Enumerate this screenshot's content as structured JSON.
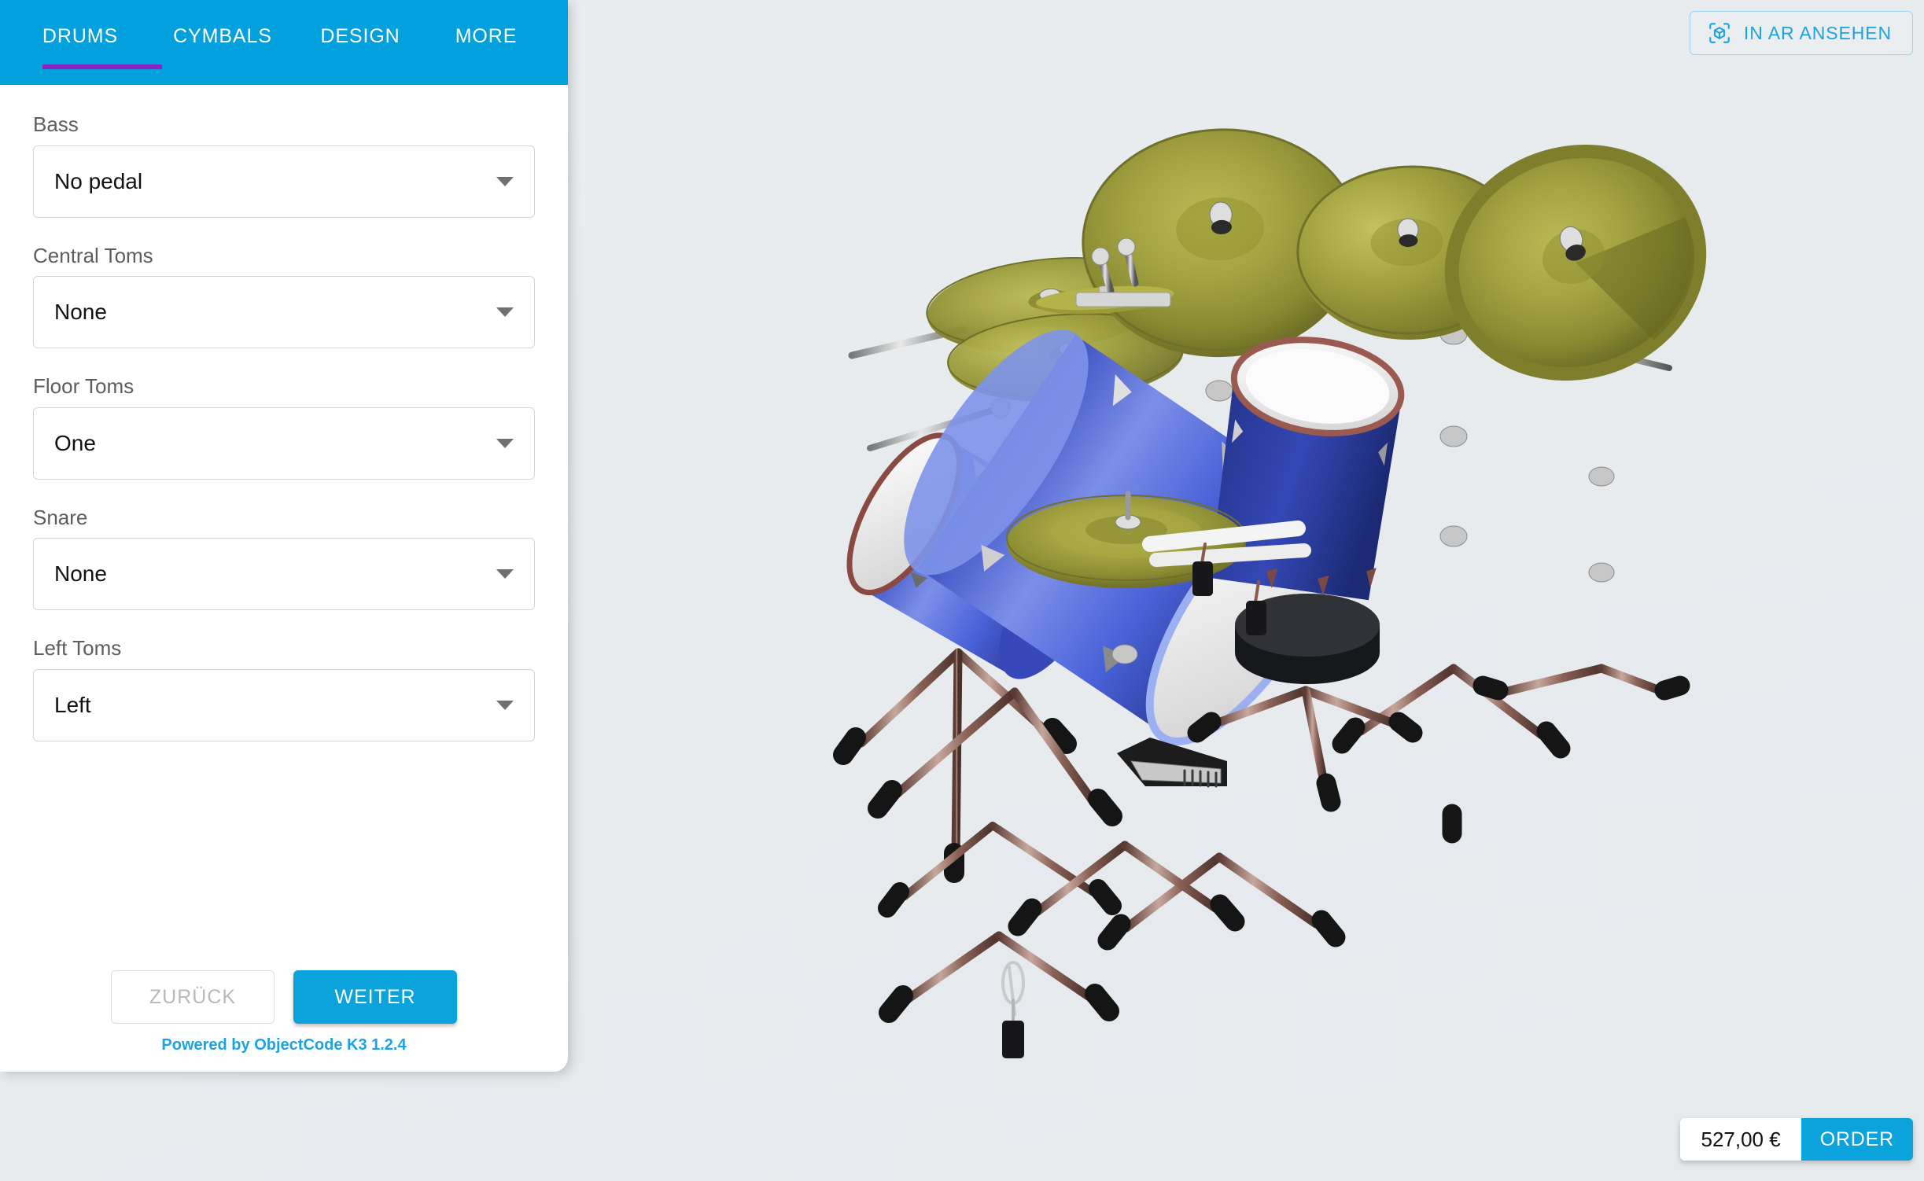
{
  "ar_button": {
    "label": "IN AR ANSEHEN",
    "icon": "ar-cube-icon",
    "color": "#1ba3dd"
  },
  "sidebar": {
    "header_color": "#02a0dc",
    "active_underline_color": "#8b22c4",
    "tabs": [
      {
        "label": "DRUMS",
        "active": true
      },
      {
        "label": "CYMBALS",
        "active": false
      },
      {
        "label": "DESIGN",
        "active": false
      },
      {
        "label": "MORE",
        "active": false
      }
    ],
    "fields": [
      {
        "label": "Bass",
        "value": "No pedal"
      },
      {
        "label": "Central Toms",
        "value": "None"
      },
      {
        "label": "Floor Toms",
        "value": "One"
      },
      {
        "label": "Snare",
        "value": "None"
      },
      {
        "label": "Left Toms",
        "value": "Left"
      }
    ],
    "back_button": "ZURÜCK",
    "next_button": "WEITER",
    "powered_by": "Powered by ObjectCode K3 1.2.4"
  },
  "pricebar": {
    "price": "527,00 €",
    "order_label": "ORDER",
    "accent_color": "#0aa3dc"
  },
  "viewport": {
    "background_color": "#e8ecef",
    "model": "drum-kit",
    "drum_color": "#4a62d8",
    "cymbal_color": "#9c9c3a"
  }
}
